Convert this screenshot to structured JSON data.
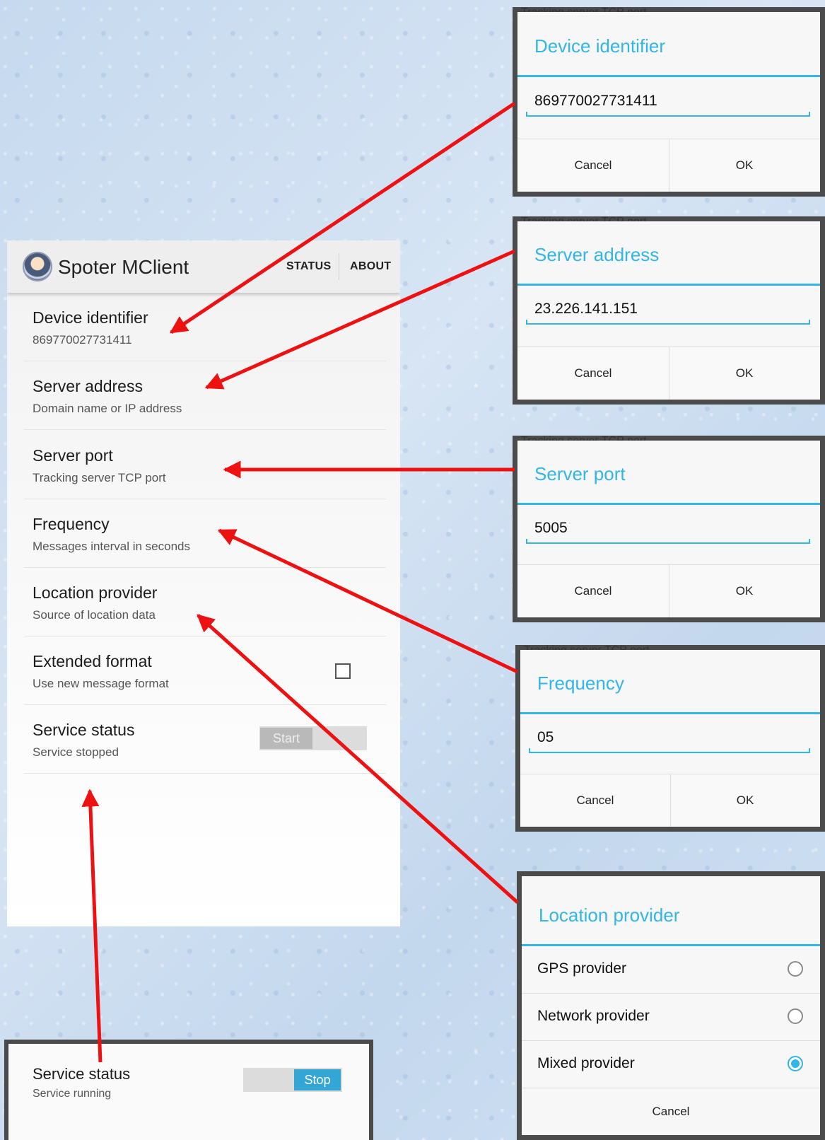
{
  "app": {
    "title": "Spoter MClient",
    "actions": {
      "status": "STATUS",
      "about": "ABOUT"
    }
  },
  "preferences": [
    {
      "title": "Device identifier",
      "summary": "869770027731411"
    },
    {
      "title": "Server address",
      "summary": "Domain name or IP address"
    },
    {
      "title": "Server port",
      "summary": "Tracking server TCP port"
    },
    {
      "title": "Frequency",
      "summary": "Messages interval in seconds"
    },
    {
      "title": "Location provider",
      "summary": "Source of location data"
    },
    {
      "title": "Extended format",
      "summary": "Use new message format",
      "checked": false
    },
    {
      "title": "Service status",
      "summary": "Service stopped",
      "toggle_label": "Start"
    }
  ],
  "service_running": {
    "title": "Service status",
    "summary": "Service running",
    "toggle_label": "Stop"
  },
  "background_caption": "Tracking server TCP port",
  "dialogs": {
    "device": {
      "title": "Device identifier",
      "value": "869770027731411",
      "cancel": "Cancel",
      "ok": "OK"
    },
    "server": {
      "title": "Server address",
      "value": "23.226.141.151",
      "cancel": "Cancel",
      "ok": "OK"
    },
    "port": {
      "title": "Server port",
      "value": "5005",
      "cancel": "Cancel",
      "ok": "OK"
    },
    "frequency": {
      "title": "Frequency",
      "value": "05",
      "cancel": "Cancel",
      "ok": "OK"
    },
    "location": {
      "title": "Location provider",
      "options": [
        {
          "label": "GPS provider",
          "selected": false
        },
        {
          "label": "Network provider",
          "selected": false
        },
        {
          "label": "Mixed provider",
          "selected": true
        }
      ],
      "cancel": "Cancel"
    }
  },
  "colors": {
    "accent": "#33b5e5",
    "arrow": "#ee1111"
  }
}
